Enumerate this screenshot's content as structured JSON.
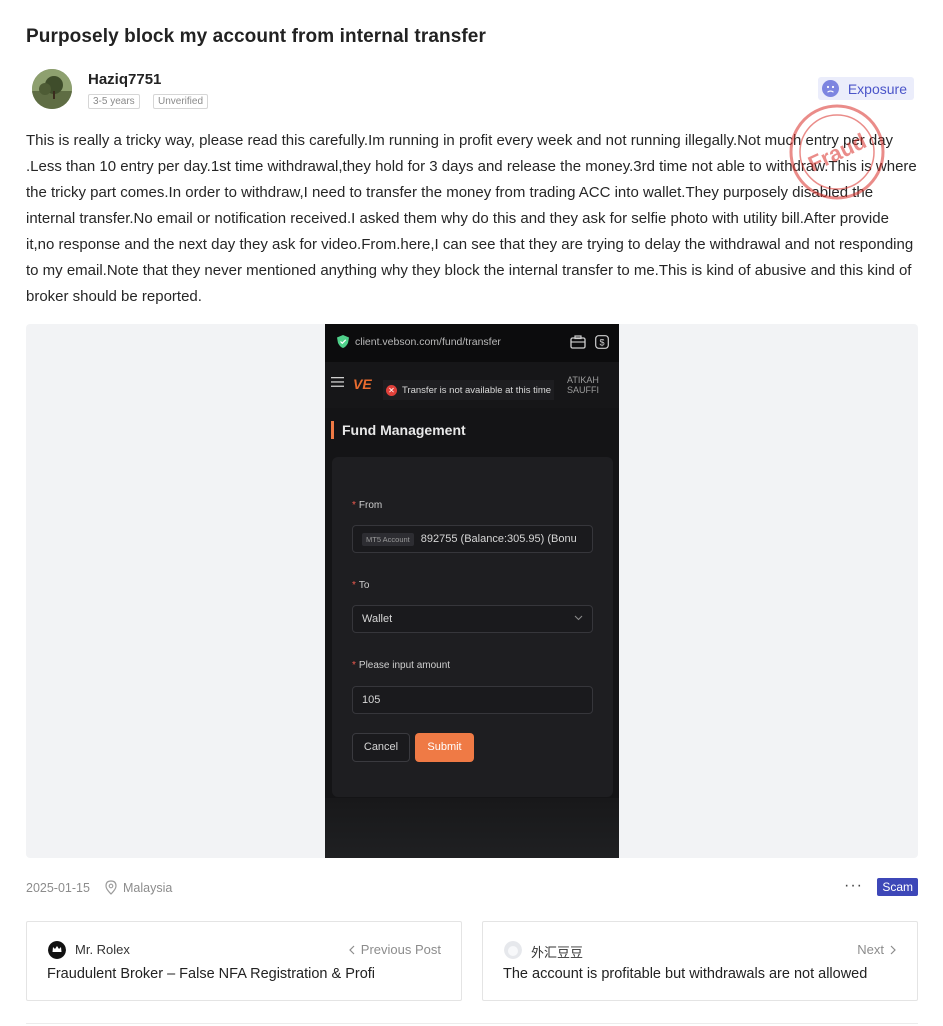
{
  "post": {
    "title": "Purposely block my account from internal transfer",
    "author": {
      "name": "Haziq7751",
      "tags": [
        "3-5 years",
        "Unverified"
      ]
    },
    "category_badge": "Exposure",
    "stamp_text": "Fraud",
    "body": "This is really a tricky way, please read this carefully.Im running in profit every week and not running illegally.Not much entry per day .Less than 10 entry per day.1st time withdrawal,they hold for 3 days and release the money.3rd time not able to withdraw.This is where the tricky part comes.In order to withdraw,I need to transfer the money from trading ACC into wallet.They purposely disabled the internal transfer.No email or notification received.I asked them why do this and they ask for selfie photo with utility bill.After provide it,no response and the next day they ask for video.From.here,I can see that they are trying to delay the withdrawal and not responding to my email.Note that they never mentioned anything why they block the internal transfer to me.This is kind of abusive and this kind of broker should be reported.",
    "date": "2025-01-15",
    "location": "Malaysia",
    "more_label": "···",
    "label_badge": "Scam"
  },
  "screenshot": {
    "url": "client.vebson.com/fund/transfer",
    "logo": "VE",
    "toast": "Transfer is not available at this time",
    "user_name": "ATIKAH SAUFFI",
    "page_title": "Fund Management",
    "from_label": "From",
    "from_tag": "MT5 Account",
    "from_value": "892755  (Balance:305.95) (Bonu",
    "to_label": "To",
    "to_value": "Wallet",
    "amount_label": "Please input amount",
    "amount_value": "105",
    "cancel_label": "Cancel",
    "submit_label": "Submit"
  },
  "navigation": {
    "previous": {
      "direction": "Previous Post",
      "author": "Mr. Rolex",
      "title": "Fraudulent Broker – False NFA Registration & Profi"
    },
    "next": {
      "direction": "Next",
      "author": "外汇豆豆",
      "title": "The account is profitable but withdrawals are not allowed"
    }
  },
  "colors": {
    "accent_orange": "#ef7a45",
    "badge_blue": "#3d47b8",
    "exposure_bg": "#ebedfb",
    "stamp_red": "#d9302a"
  }
}
